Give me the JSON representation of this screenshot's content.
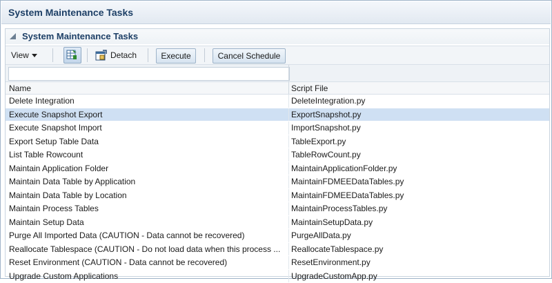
{
  "window": {
    "title": "System Maintenance Tasks"
  },
  "panel": {
    "title": "System Maintenance Tasks"
  },
  "toolbar": {
    "view_label": "View",
    "detach_label": "Detach",
    "execute_label": "Execute",
    "cancel_schedule_label": "Cancel Schedule"
  },
  "table": {
    "columns": [
      "Name",
      "Script File"
    ],
    "rows": [
      {
        "name": "Delete Integration",
        "script": "DeleteIntegration.py"
      },
      {
        "name": "Execute Snapshot Export",
        "script": "ExportSnapshot.py",
        "selected": true
      },
      {
        "name": "Execute Snapshot Import",
        "script": "ImportSnapshot.py"
      },
      {
        "name": "Export Setup Table Data",
        "script": "TableExport.py"
      },
      {
        "name": "List Table Rowcount",
        "script": "TableRowCount.py"
      },
      {
        "name": "Maintain Application Folder",
        "script": "MaintainApplicationFolder.py"
      },
      {
        "name": "Maintain Data Table by Application",
        "script": "MaintainFDMEEDataTables.py"
      },
      {
        "name": "Maintain Data Table by Location",
        "script": "MaintainFDMEEDataTables.py"
      },
      {
        "name": "Maintain Process Tables",
        "script": "MaintainProcessTables.py"
      },
      {
        "name": "Maintain Setup Data",
        "script": "MaintainSetupData.py"
      },
      {
        "name": "Purge All Imported Data (CAUTION - Data cannot be recovered)",
        "script": "PurgeAllData.py"
      },
      {
        "name": "Reallocate Tablespace (CAUTION - Do not load data when this process ...",
        "script": "ReallocateTablespace.py"
      },
      {
        "name": "Reset Environment (CAUTION - Data cannot be recovered)",
        "script": "ResetEnvironment.py"
      },
      {
        "name": "Upgrade Custom Applications",
        "script": "UpgradeCustomApp.py"
      }
    ]
  },
  "colors": {
    "selected_row": "#cfe0f3",
    "title_text": "#1d3f66"
  },
  "icons": [
    "collapse-triangle-icon",
    "chevron-down-icon",
    "freeze-columns-icon",
    "detach-icon"
  ]
}
